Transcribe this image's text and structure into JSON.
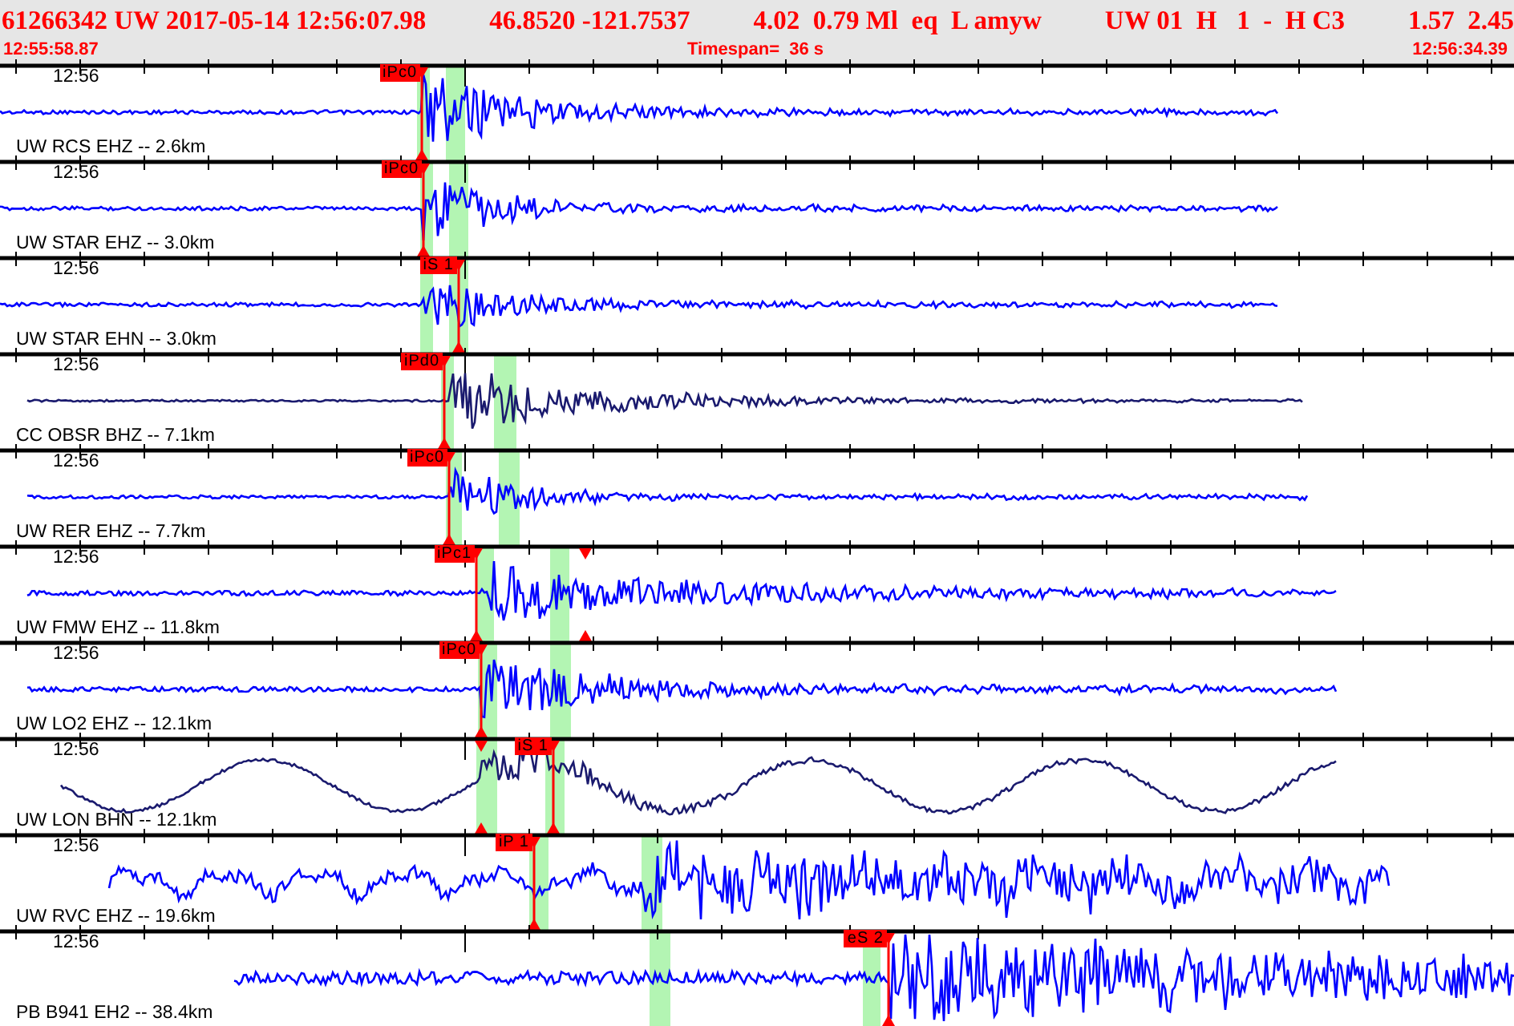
{
  "header": {
    "title_fields": [
      "61266342 UW 2017-05-14 12:56:07.98",
      "46.8520 -121.7537",
      "4.02  0.79 Ml  eq  L amyw",
      "UW 01  H   1  -  H C3",
      "1.57  2.45"
    ],
    "start_time": "12:55:58.87",
    "timespan": "Timespan=  36 s",
    "end_time": "12:56:34.39"
  },
  "traces": [
    {
      "time_label": "12:56",
      "station_label": "UW RCS EHZ -- 2.6km",
      "color": "#0000ff",
      "pick": "iPc0"
    },
    {
      "time_label": "12:56",
      "station_label": "UW STAR EHZ -- 3.0km",
      "color": "#0000ff",
      "pick": "iPc0"
    },
    {
      "time_label": "12:56",
      "station_label": "UW STAR EHN -- 3.0km",
      "color": "#0000ff",
      "pick": "iS 1"
    },
    {
      "time_label": "12:56",
      "station_label": "CC OBSR BHZ -- 7.1km",
      "color": "#1a1a6e",
      "pick": "iPd0"
    },
    {
      "time_label": "12:56",
      "station_label": "UW RER EHZ -- 7.7km",
      "color": "#0000ff",
      "pick": "iPc0"
    },
    {
      "time_label": "12:56",
      "station_label": "UW FMW EHZ -- 11.8km",
      "color": "#0000ff",
      "pick": "iPc1"
    },
    {
      "time_label": "12:56",
      "station_label": "UW LO2 EHZ -- 12.1km",
      "color": "#0000ff",
      "pick": "iPc0"
    },
    {
      "time_label": "12:56",
      "station_label": "UW LON BHN -- 12.1km",
      "color": "#1a1a6e",
      "pick": "iS 1"
    },
    {
      "time_label": "12:56",
      "station_label": "UW RVC EHZ -- 19.6km",
      "color": "#0000ff",
      "pick": "iP 1"
    },
    {
      "time_label": "12:56",
      "station_label": "PB B941 EH2 -- 38.4km",
      "color": "#0000ff",
      "pick": "eS 2"
    }
  ]
}
